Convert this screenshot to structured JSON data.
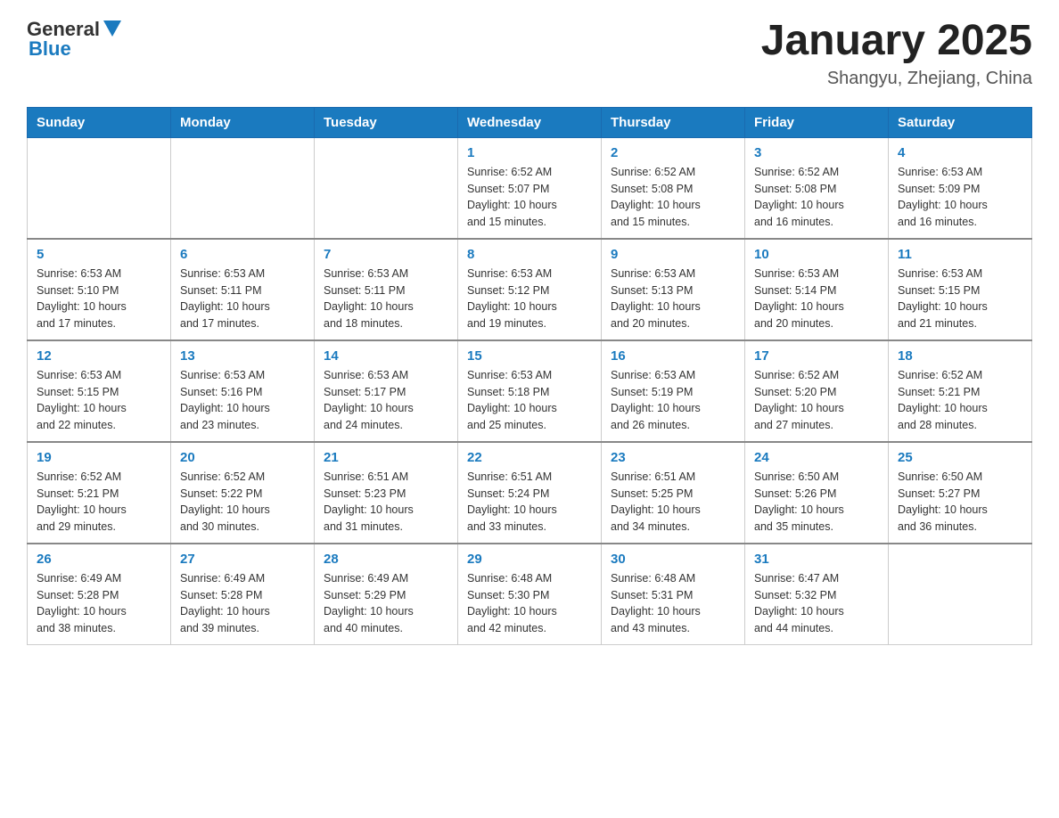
{
  "header": {
    "logo_general": "General",
    "logo_blue": "Blue",
    "month_title": "January 2025",
    "location": "Shangyu, Zhejiang, China"
  },
  "days_of_week": [
    "Sunday",
    "Monday",
    "Tuesday",
    "Wednesday",
    "Thursday",
    "Friday",
    "Saturday"
  ],
  "weeks": [
    [
      {
        "day": "",
        "info": ""
      },
      {
        "day": "",
        "info": ""
      },
      {
        "day": "",
        "info": ""
      },
      {
        "day": "1",
        "info": "Sunrise: 6:52 AM\nSunset: 5:07 PM\nDaylight: 10 hours\nand 15 minutes."
      },
      {
        "day": "2",
        "info": "Sunrise: 6:52 AM\nSunset: 5:08 PM\nDaylight: 10 hours\nand 15 minutes."
      },
      {
        "day": "3",
        "info": "Sunrise: 6:52 AM\nSunset: 5:08 PM\nDaylight: 10 hours\nand 16 minutes."
      },
      {
        "day": "4",
        "info": "Sunrise: 6:53 AM\nSunset: 5:09 PM\nDaylight: 10 hours\nand 16 minutes."
      }
    ],
    [
      {
        "day": "5",
        "info": "Sunrise: 6:53 AM\nSunset: 5:10 PM\nDaylight: 10 hours\nand 17 minutes."
      },
      {
        "day": "6",
        "info": "Sunrise: 6:53 AM\nSunset: 5:11 PM\nDaylight: 10 hours\nand 17 minutes."
      },
      {
        "day": "7",
        "info": "Sunrise: 6:53 AM\nSunset: 5:11 PM\nDaylight: 10 hours\nand 18 minutes."
      },
      {
        "day": "8",
        "info": "Sunrise: 6:53 AM\nSunset: 5:12 PM\nDaylight: 10 hours\nand 19 minutes."
      },
      {
        "day": "9",
        "info": "Sunrise: 6:53 AM\nSunset: 5:13 PM\nDaylight: 10 hours\nand 20 minutes."
      },
      {
        "day": "10",
        "info": "Sunrise: 6:53 AM\nSunset: 5:14 PM\nDaylight: 10 hours\nand 20 minutes."
      },
      {
        "day": "11",
        "info": "Sunrise: 6:53 AM\nSunset: 5:15 PM\nDaylight: 10 hours\nand 21 minutes."
      }
    ],
    [
      {
        "day": "12",
        "info": "Sunrise: 6:53 AM\nSunset: 5:15 PM\nDaylight: 10 hours\nand 22 minutes."
      },
      {
        "day": "13",
        "info": "Sunrise: 6:53 AM\nSunset: 5:16 PM\nDaylight: 10 hours\nand 23 minutes."
      },
      {
        "day": "14",
        "info": "Sunrise: 6:53 AM\nSunset: 5:17 PM\nDaylight: 10 hours\nand 24 minutes."
      },
      {
        "day": "15",
        "info": "Sunrise: 6:53 AM\nSunset: 5:18 PM\nDaylight: 10 hours\nand 25 minutes."
      },
      {
        "day": "16",
        "info": "Sunrise: 6:53 AM\nSunset: 5:19 PM\nDaylight: 10 hours\nand 26 minutes."
      },
      {
        "day": "17",
        "info": "Sunrise: 6:52 AM\nSunset: 5:20 PM\nDaylight: 10 hours\nand 27 minutes."
      },
      {
        "day": "18",
        "info": "Sunrise: 6:52 AM\nSunset: 5:21 PM\nDaylight: 10 hours\nand 28 minutes."
      }
    ],
    [
      {
        "day": "19",
        "info": "Sunrise: 6:52 AM\nSunset: 5:21 PM\nDaylight: 10 hours\nand 29 minutes."
      },
      {
        "day": "20",
        "info": "Sunrise: 6:52 AM\nSunset: 5:22 PM\nDaylight: 10 hours\nand 30 minutes."
      },
      {
        "day": "21",
        "info": "Sunrise: 6:51 AM\nSunset: 5:23 PM\nDaylight: 10 hours\nand 31 minutes."
      },
      {
        "day": "22",
        "info": "Sunrise: 6:51 AM\nSunset: 5:24 PM\nDaylight: 10 hours\nand 33 minutes."
      },
      {
        "day": "23",
        "info": "Sunrise: 6:51 AM\nSunset: 5:25 PM\nDaylight: 10 hours\nand 34 minutes."
      },
      {
        "day": "24",
        "info": "Sunrise: 6:50 AM\nSunset: 5:26 PM\nDaylight: 10 hours\nand 35 minutes."
      },
      {
        "day": "25",
        "info": "Sunrise: 6:50 AM\nSunset: 5:27 PM\nDaylight: 10 hours\nand 36 minutes."
      }
    ],
    [
      {
        "day": "26",
        "info": "Sunrise: 6:49 AM\nSunset: 5:28 PM\nDaylight: 10 hours\nand 38 minutes."
      },
      {
        "day": "27",
        "info": "Sunrise: 6:49 AM\nSunset: 5:28 PM\nDaylight: 10 hours\nand 39 minutes."
      },
      {
        "day": "28",
        "info": "Sunrise: 6:49 AM\nSunset: 5:29 PM\nDaylight: 10 hours\nand 40 minutes."
      },
      {
        "day": "29",
        "info": "Sunrise: 6:48 AM\nSunset: 5:30 PM\nDaylight: 10 hours\nand 42 minutes."
      },
      {
        "day": "30",
        "info": "Sunrise: 6:48 AM\nSunset: 5:31 PM\nDaylight: 10 hours\nand 43 minutes."
      },
      {
        "day": "31",
        "info": "Sunrise: 6:47 AM\nSunset: 5:32 PM\nDaylight: 10 hours\nand 44 minutes."
      },
      {
        "day": "",
        "info": ""
      }
    ]
  ]
}
